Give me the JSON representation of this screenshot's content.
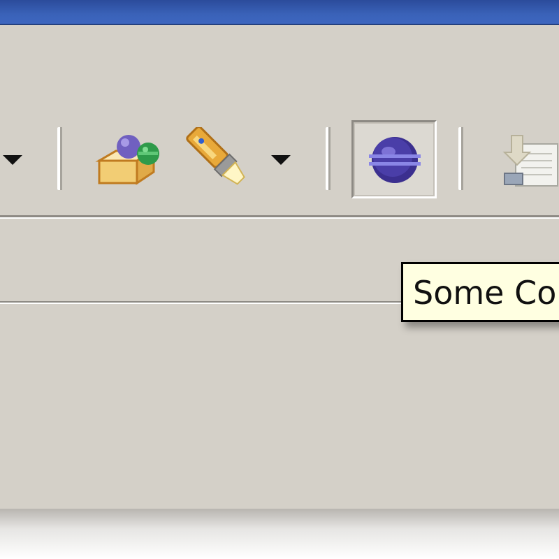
{
  "tooltip": {
    "text": "Some Co"
  },
  "toolbar": {
    "items": [
      {
        "icon": "dropdown-arrow-icon"
      },
      {
        "icon": "new-package-icon"
      },
      {
        "icon": "highlighter-icon"
      },
      {
        "icon": "dropdown-arrow-icon"
      },
      {
        "icon": "eclipse-perspective-icon",
        "state": "pressed"
      },
      {
        "icon": "import-icon"
      }
    ]
  },
  "colors": {
    "window_bg": "#d4d0c8",
    "titlebar": "#3a62b8",
    "tooltip_bg": "#ffffe1"
  }
}
